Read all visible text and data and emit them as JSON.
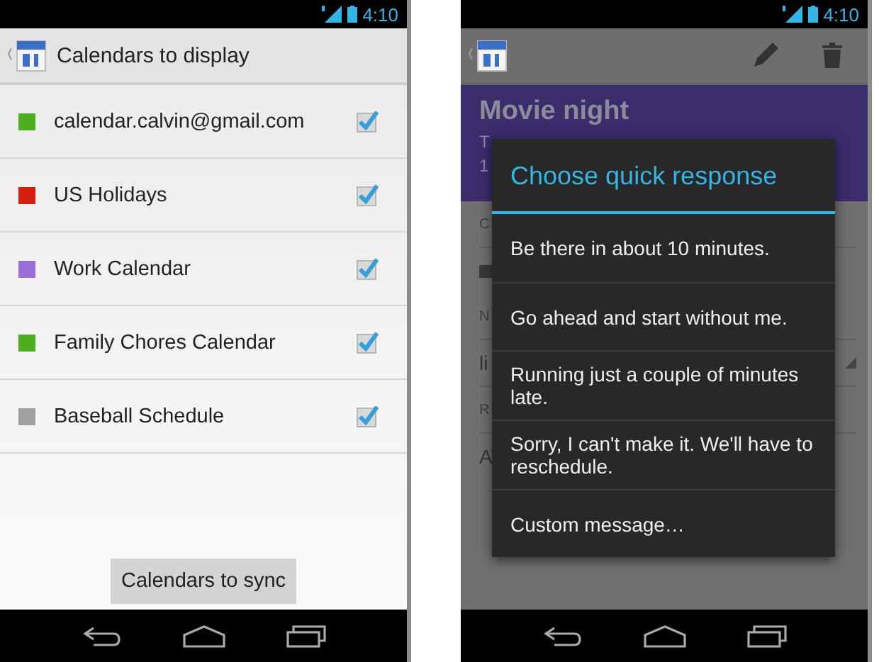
{
  "calendars_screen": {
    "status_bar": {
      "time": "4:10"
    },
    "action_bar": {
      "title": "Calendars to display"
    },
    "calendars": [
      {
        "name": "calendar.calvin@gmail.com",
        "color": "#4caf1e",
        "checked": true
      },
      {
        "name": "US Holidays",
        "color": "#d6200f",
        "checked": true
      },
      {
        "name": "Work Calendar",
        "color": "#9a70d8",
        "checked": true
      },
      {
        "name": "Family Chores Calendar",
        "color": "#4caf1e",
        "checked": true
      },
      {
        "name": "Baseball Schedule",
        "color": "#a0a0a0",
        "checked": true
      }
    ],
    "button": "Calendars to sync"
  },
  "event_screen": {
    "status_bar": {
      "time": "4:10"
    },
    "event": {
      "title": "Movie night",
      "header_lines": [
        "T",
        "1"
      ],
      "details": [
        {
          "kind": "label",
          "text": "C"
        },
        {
          "kind": "mail"
        },
        {
          "kind": "label",
          "text": "N"
        },
        {
          "kind": "dropdown",
          "text": "li"
        },
        {
          "kind": "label",
          "text": "R"
        },
        {
          "kind": "value",
          "text": "A"
        }
      ]
    },
    "dialog": {
      "title": "Choose quick response",
      "options": [
        "Be there in about 10 minutes.",
        "Go ahead and start without me.",
        "Running just a couple of minutes late.",
        "Sorry, I can't make it. We'll have to reschedule.",
        "Custom message…"
      ]
    }
  }
}
